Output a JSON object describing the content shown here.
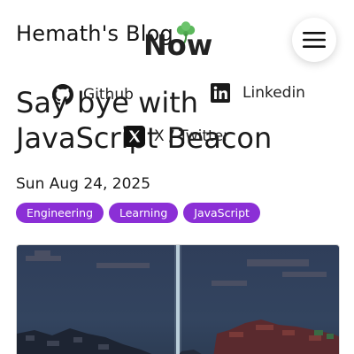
{
  "header": {
    "site_title": "Hemath's Blog",
    "logo_icon": "clover-icon",
    "menu_icon": "hamburger-menu-icon"
  },
  "nav": {
    "now_label": "Now",
    "github": {
      "label": "Github",
      "icon": "github-icon"
    },
    "linkedin": {
      "label": "Linkedin",
      "icon": "linkedin-icon"
    },
    "twitter": {
      "label": "X / Twitter",
      "icon": "x-icon"
    }
  },
  "post": {
    "title": "Say bye with JavaScript Beacon",
    "date": "Sun Aug 24, 2025",
    "tags": [
      "Engineering",
      "Learning",
      "JavaScript"
    ],
    "hero_image": {
      "icon": "hero-image",
      "description_shown": ""
    }
  },
  "colors": {
    "tag_background": "#8b2fd6",
    "tag_text": "#ffffff",
    "text": "#1a1a1a",
    "background": "#ffffff"
  }
}
